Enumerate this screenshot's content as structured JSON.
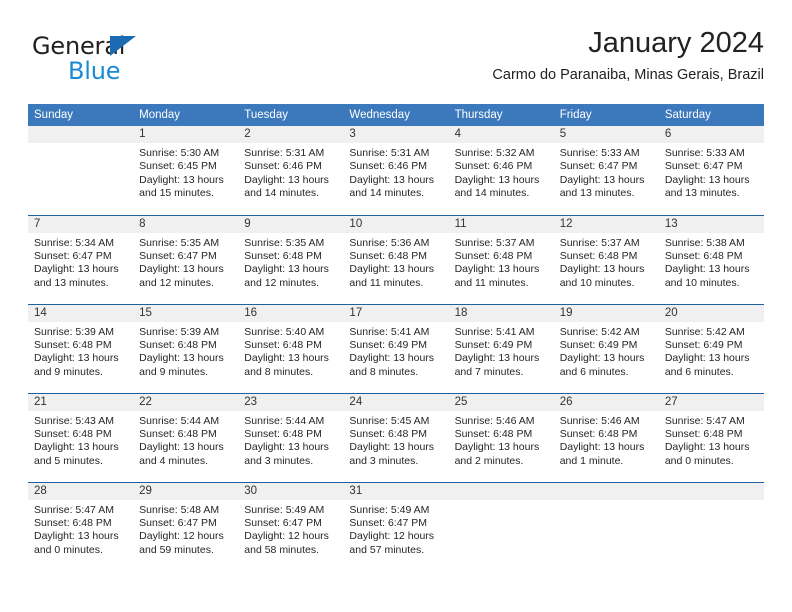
{
  "logo": {
    "text_top": "General",
    "text_bottom": "Blue",
    "triangle_color": "#1b6bb3",
    "top_color": "#231f20",
    "bottom_color": "#1a8ad4"
  },
  "header": {
    "title": "January 2024",
    "subtitle": "Carmo do Paranaiba, Minas Gerais, Brazil"
  },
  "theme": {
    "header_bg": "#3b78bc",
    "row_rule": "#1f5fa3",
    "daynum_bg": "#f0f0f0"
  },
  "weekdays": [
    "Sunday",
    "Monday",
    "Tuesday",
    "Wednesday",
    "Thursday",
    "Friday",
    "Saturday"
  ],
  "weeks": [
    [
      {
        "day": "",
        "sunrise": "",
        "sunset": "",
        "daylight_l1": "",
        "daylight_l2": "",
        "empty": true
      },
      {
        "day": "1",
        "sunrise": "Sunrise: 5:30 AM",
        "sunset": "Sunset: 6:45 PM",
        "daylight_l1": "Daylight: 13 hours",
        "daylight_l2": "and 15 minutes."
      },
      {
        "day": "2",
        "sunrise": "Sunrise: 5:31 AM",
        "sunset": "Sunset: 6:46 PM",
        "daylight_l1": "Daylight: 13 hours",
        "daylight_l2": "and 14 minutes."
      },
      {
        "day": "3",
        "sunrise": "Sunrise: 5:31 AM",
        "sunset": "Sunset: 6:46 PM",
        "daylight_l1": "Daylight: 13 hours",
        "daylight_l2": "and 14 minutes."
      },
      {
        "day": "4",
        "sunrise": "Sunrise: 5:32 AM",
        "sunset": "Sunset: 6:46 PM",
        "daylight_l1": "Daylight: 13 hours",
        "daylight_l2": "and 14 minutes."
      },
      {
        "day": "5",
        "sunrise": "Sunrise: 5:33 AM",
        "sunset": "Sunset: 6:47 PM",
        "daylight_l1": "Daylight: 13 hours",
        "daylight_l2": "and 13 minutes."
      },
      {
        "day": "6",
        "sunrise": "Sunrise: 5:33 AM",
        "sunset": "Sunset: 6:47 PM",
        "daylight_l1": "Daylight: 13 hours",
        "daylight_l2": "and 13 minutes."
      }
    ],
    [
      {
        "day": "7",
        "sunrise": "Sunrise: 5:34 AM",
        "sunset": "Sunset: 6:47 PM",
        "daylight_l1": "Daylight: 13 hours",
        "daylight_l2": "and 13 minutes."
      },
      {
        "day": "8",
        "sunrise": "Sunrise: 5:35 AM",
        "sunset": "Sunset: 6:47 PM",
        "daylight_l1": "Daylight: 13 hours",
        "daylight_l2": "and 12 minutes."
      },
      {
        "day": "9",
        "sunrise": "Sunrise: 5:35 AM",
        "sunset": "Sunset: 6:48 PM",
        "daylight_l1": "Daylight: 13 hours",
        "daylight_l2": "and 12 minutes."
      },
      {
        "day": "10",
        "sunrise": "Sunrise: 5:36 AM",
        "sunset": "Sunset: 6:48 PM",
        "daylight_l1": "Daylight: 13 hours",
        "daylight_l2": "and 11 minutes."
      },
      {
        "day": "11",
        "sunrise": "Sunrise: 5:37 AM",
        "sunset": "Sunset: 6:48 PM",
        "daylight_l1": "Daylight: 13 hours",
        "daylight_l2": "and 11 minutes."
      },
      {
        "day": "12",
        "sunrise": "Sunrise: 5:37 AM",
        "sunset": "Sunset: 6:48 PM",
        "daylight_l1": "Daylight: 13 hours",
        "daylight_l2": "and 10 minutes."
      },
      {
        "day": "13",
        "sunrise": "Sunrise: 5:38 AM",
        "sunset": "Sunset: 6:48 PM",
        "daylight_l1": "Daylight: 13 hours",
        "daylight_l2": "and 10 minutes."
      }
    ],
    [
      {
        "day": "14",
        "sunrise": "Sunrise: 5:39 AM",
        "sunset": "Sunset: 6:48 PM",
        "daylight_l1": "Daylight: 13 hours",
        "daylight_l2": "and 9 minutes."
      },
      {
        "day": "15",
        "sunrise": "Sunrise: 5:39 AM",
        "sunset": "Sunset: 6:48 PM",
        "daylight_l1": "Daylight: 13 hours",
        "daylight_l2": "and 9 minutes."
      },
      {
        "day": "16",
        "sunrise": "Sunrise: 5:40 AM",
        "sunset": "Sunset: 6:48 PM",
        "daylight_l1": "Daylight: 13 hours",
        "daylight_l2": "and 8 minutes."
      },
      {
        "day": "17",
        "sunrise": "Sunrise: 5:41 AM",
        "sunset": "Sunset: 6:49 PM",
        "daylight_l1": "Daylight: 13 hours",
        "daylight_l2": "and 8 minutes."
      },
      {
        "day": "18",
        "sunrise": "Sunrise: 5:41 AM",
        "sunset": "Sunset: 6:49 PM",
        "daylight_l1": "Daylight: 13 hours",
        "daylight_l2": "and 7 minutes."
      },
      {
        "day": "19",
        "sunrise": "Sunrise: 5:42 AM",
        "sunset": "Sunset: 6:49 PM",
        "daylight_l1": "Daylight: 13 hours",
        "daylight_l2": "and 6 minutes."
      },
      {
        "day": "20",
        "sunrise": "Sunrise: 5:42 AM",
        "sunset": "Sunset: 6:49 PM",
        "daylight_l1": "Daylight: 13 hours",
        "daylight_l2": "and 6 minutes."
      }
    ],
    [
      {
        "day": "21",
        "sunrise": "Sunrise: 5:43 AM",
        "sunset": "Sunset: 6:48 PM",
        "daylight_l1": "Daylight: 13 hours",
        "daylight_l2": "and 5 minutes."
      },
      {
        "day": "22",
        "sunrise": "Sunrise: 5:44 AM",
        "sunset": "Sunset: 6:48 PM",
        "daylight_l1": "Daylight: 13 hours",
        "daylight_l2": "and 4 minutes."
      },
      {
        "day": "23",
        "sunrise": "Sunrise: 5:44 AM",
        "sunset": "Sunset: 6:48 PM",
        "daylight_l1": "Daylight: 13 hours",
        "daylight_l2": "and 3 minutes."
      },
      {
        "day": "24",
        "sunrise": "Sunrise: 5:45 AM",
        "sunset": "Sunset: 6:48 PM",
        "daylight_l1": "Daylight: 13 hours",
        "daylight_l2": "and 3 minutes."
      },
      {
        "day": "25",
        "sunrise": "Sunrise: 5:46 AM",
        "sunset": "Sunset: 6:48 PM",
        "daylight_l1": "Daylight: 13 hours",
        "daylight_l2": "and 2 minutes."
      },
      {
        "day": "26",
        "sunrise": "Sunrise: 5:46 AM",
        "sunset": "Sunset: 6:48 PM",
        "daylight_l1": "Daylight: 13 hours",
        "daylight_l2": "and 1 minute."
      },
      {
        "day": "27",
        "sunrise": "Sunrise: 5:47 AM",
        "sunset": "Sunset: 6:48 PM",
        "daylight_l1": "Daylight: 13 hours",
        "daylight_l2": "and 0 minutes."
      }
    ],
    [
      {
        "day": "28",
        "sunrise": "Sunrise: 5:47 AM",
        "sunset": "Sunset: 6:48 PM",
        "daylight_l1": "Daylight: 13 hours",
        "daylight_l2": "and 0 minutes."
      },
      {
        "day": "29",
        "sunrise": "Sunrise: 5:48 AM",
        "sunset": "Sunset: 6:47 PM",
        "daylight_l1": "Daylight: 12 hours",
        "daylight_l2": "and 59 minutes."
      },
      {
        "day": "30",
        "sunrise": "Sunrise: 5:49 AM",
        "sunset": "Sunset: 6:47 PM",
        "daylight_l1": "Daylight: 12 hours",
        "daylight_l2": "and 58 minutes."
      },
      {
        "day": "31",
        "sunrise": "Sunrise: 5:49 AM",
        "sunset": "Sunset: 6:47 PM",
        "daylight_l1": "Daylight: 12 hours",
        "daylight_l2": "and 57 minutes."
      },
      {
        "day": "",
        "sunrise": "",
        "sunset": "",
        "daylight_l1": "",
        "daylight_l2": "",
        "empty": true
      },
      {
        "day": "",
        "sunrise": "",
        "sunset": "",
        "daylight_l1": "",
        "daylight_l2": "",
        "empty": true
      },
      {
        "day": "",
        "sunrise": "",
        "sunset": "",
        "daylight_l1": "",
        "daylight_l2": "",
        "empty": true
      }
    ]
  ]
}
